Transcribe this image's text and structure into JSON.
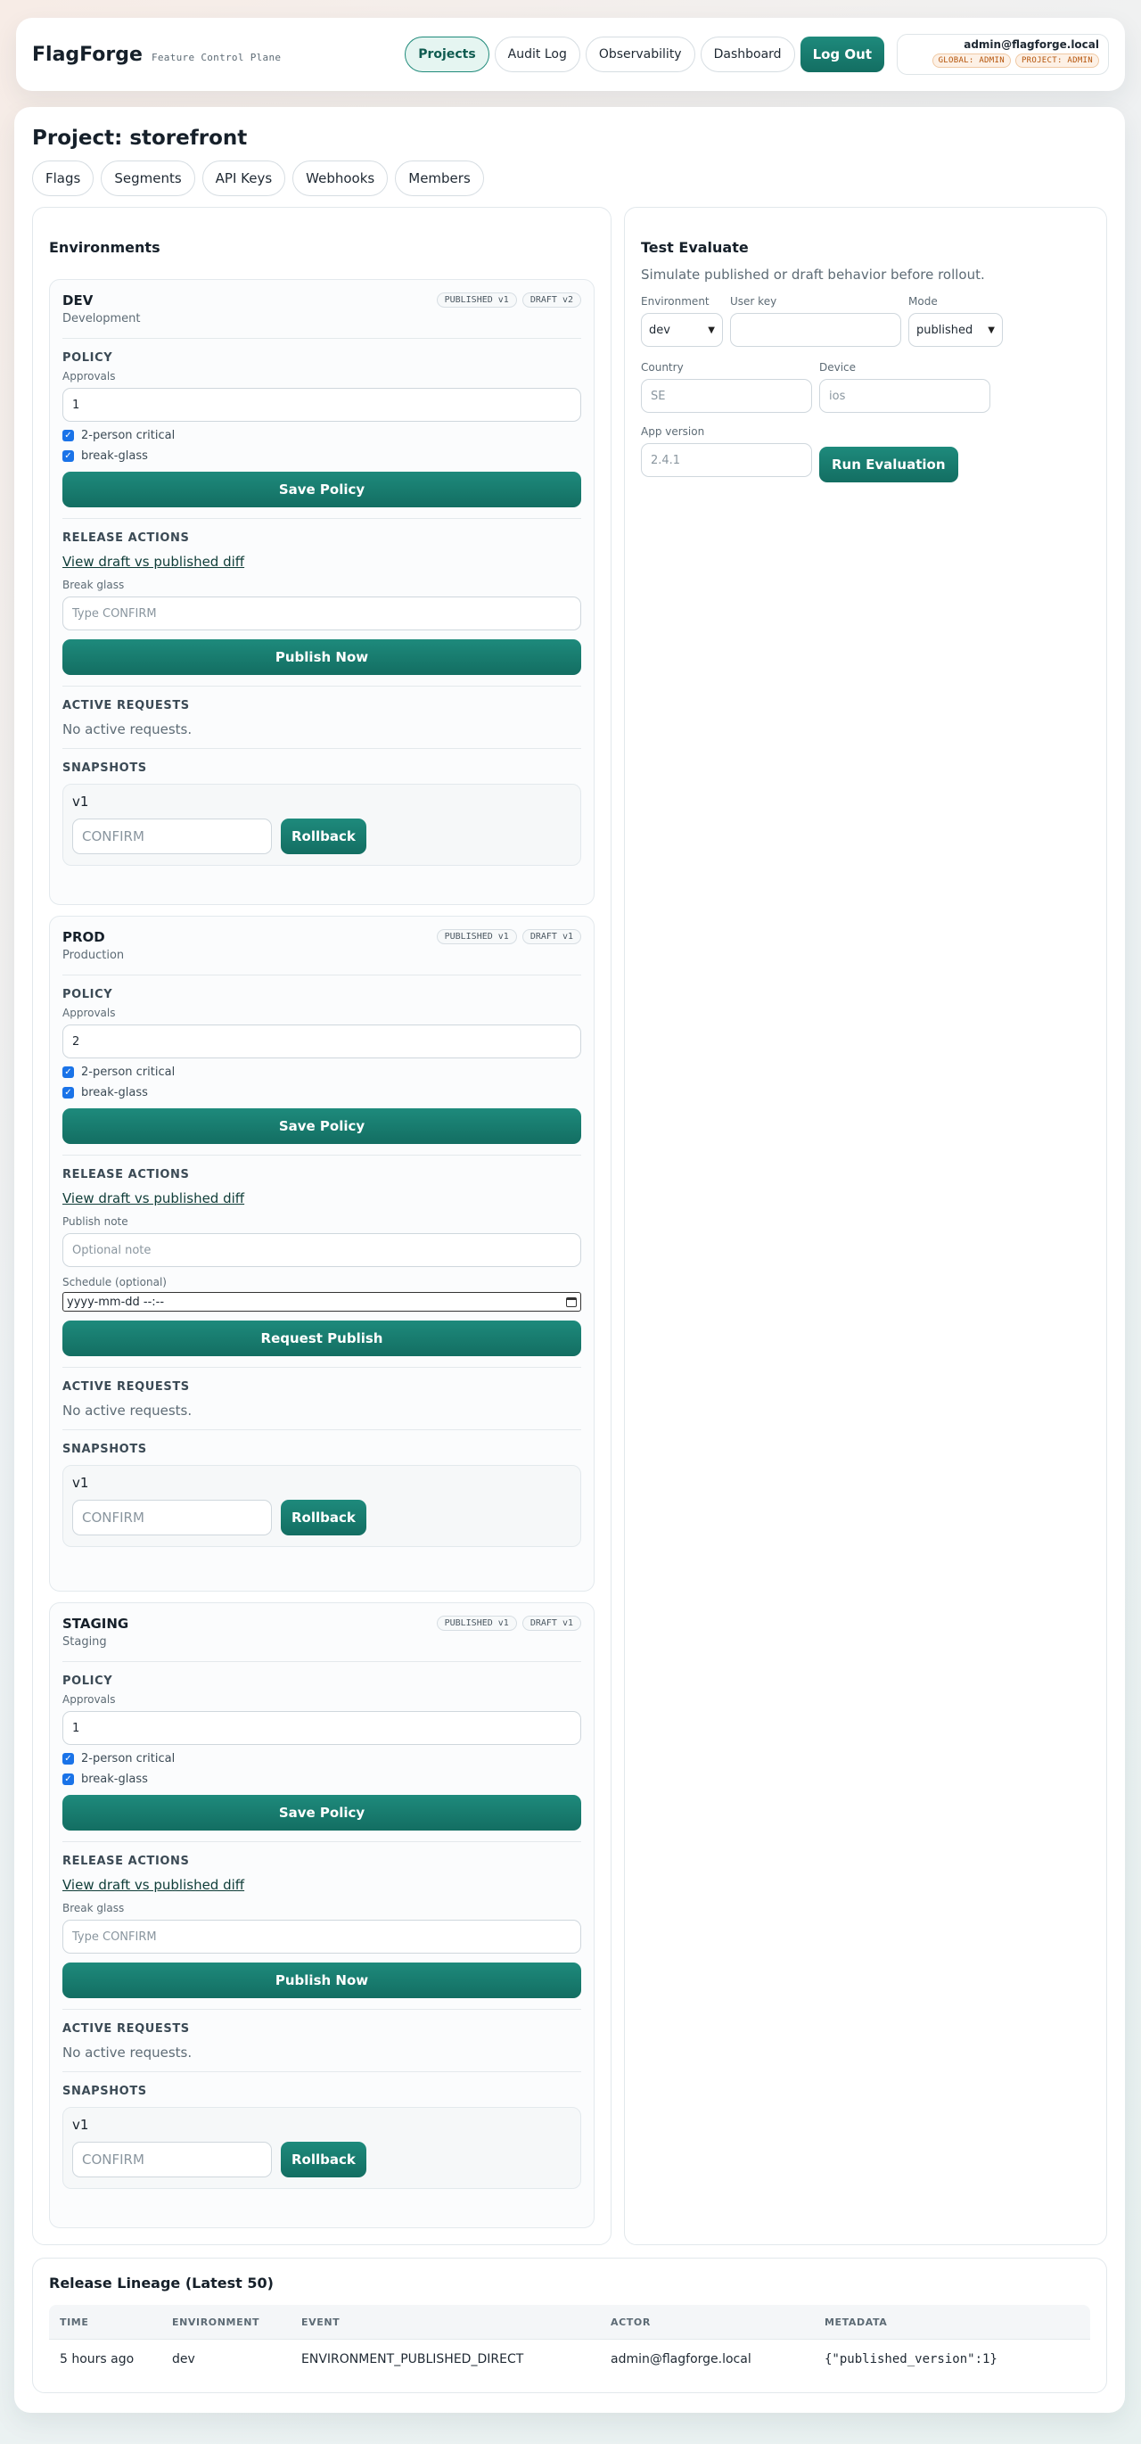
{
  "header": {
    "brand": "FlagForge",
    "tagline": "Feature Control Plane",
    "nav": [
      "Projects",
      "Audit Log",
      "Observability",
      "Dashboard"
    ],
    "logout": "Log Out",
    "user_email": "admin@flagforge.local",
    "roles": [
      "GLOBAL: ADMIN",
      "PROJECT: ADMIN"
    ]
  },
  "project": {
    "title": "Project: storefront",
    "tabs": [
      "Flags",
      "Segments",
      "API Keys",
      "Webhooks",
      "Members"
    ]
  },
  "environments_panel": {
    "title": "Environments",
    "labels": {
      "policy": "POLICY",
      "approvals": "Approvals",
      "two_person": "2-person critical",
      "break_glass_check": "break-glass",
      "save_policy": "Save Policy",
      "release_actions": "RELEASE ACTIONS",
      "diff_link": "View draft vs published diff",
      "active_requests": "ACTIVE REQUESTS",
      "no_requests": "No active requests.",
      "snapshots": "SNAPSHOTS",
      "rollback": "Rollback",
      "confirm_placeholder": "CONFIRM"
    },
    "envs": [
      {
        "name": "DEV",
        "desc": "Development",
        "published": "PUBLISHED v1",
        "draft": "DRAFT v2",
        "approvals": "1",
        "break_glass_label": "Break glass",
        "break_glass_placeholder": "Type CONFIRM",
        "action_button": "Publish Now",
        "snapshot": "v1"
      },
      {
        "name": "PROD",
        "desc": "Production",
        "published": "PUBLISHED v1",
        "draft": "DRAFT v1",
        "approvals": "2",
        "publish_note_label": "Publish note",
        "publish_note_placeholder": "Optional note",
        "schedule_label": "Schedule (optional)",
        "schedule_value": "yyyy-mm-dd --:--",
        "action_button": "Request Publish",
        "snapshot": "v1"
      },
      {
        "name": "STAGING",
        "desc": "Staging",
        "published": "PUBLISHED v1",
        "draft": "DRAFT v1",
        "approvals": "1",
        "break_glass_label": "Break glass",
        "break_glass_placeholder": "Type CONFIRM",
        "action_button": "Publish Now",
        "snapshot": "v1"
      }
    ]
  },
  "evaluate": {
    "title": "Test Evaluate",
    "subtitle": "Simulate published or draft behavior before rollout.",
    "environment_label": "Environment",
    "environment_value": "dev",
    "user_key_label": "User key",
    "user_key_value": "",
    "mode_label": "Mode",
    "mode_value": "published",
    "country_label": "Country",
    "country_placeholder": "SE",
    "device_label": "Device",
    "device_placeholder": "ios",
    "app_version_label": "App version",
    "app_version_placeholder": "2.4.1",
    "run_button": "Run Evaluation"
  },
  "lineage": {
    "title": "Release Lineage (Latest 50)",
    "columns": [
      "TIME",
      "ENVIRONMENT",
      "EVENT",
      "ACTOR",
      "METADATA"
    ],
    "rows": [
      [
        "5 hours ago",
        "dev",
        "ENVIRONMENT_PUBLISHED_DIRECT",
        "admin@flagforge.local",
        "{\"published_version\":1}"
      ]
    ]
  },
  "colors": {
    "accent": "#1a7f72",
    "role_badge": "#b45309"
  }
}
